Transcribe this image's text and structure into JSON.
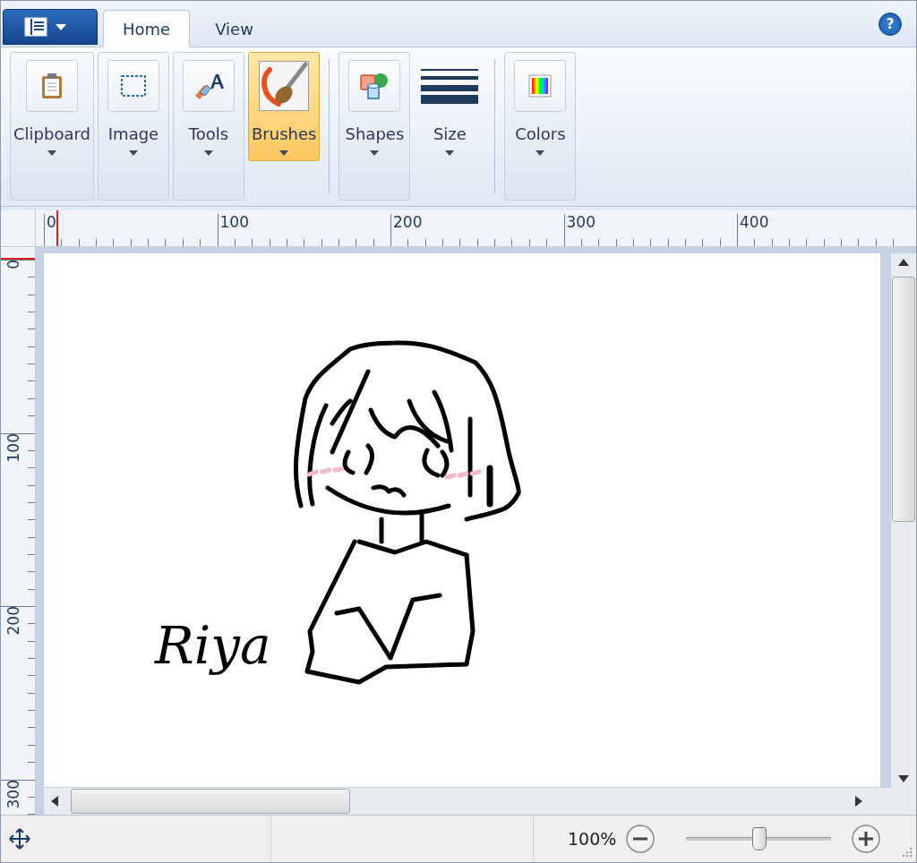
{
  "app_menu": {
    "expanded": false
  },
  "tabs": [
    {
      "label": "Home",
      "selected": true
    },
    {
      "label": "View",
      "selected": false
    }
  ],
  "help_button": {
    "label": "?"
  },
  "ribbon": [
    {
      "kind": "group",
      "label": "Clipboard",
      "selected": false
    },
    {
      "kind": "group",
      "label": "Image",
      "selected": false
    },
    {
      "kind": "group",
      "label": "Tools",
      "selected": false
    },
    {
      "kind": "group",
      "label": "Brushes",
      "selected": true
    },
    {
      "kind": "separator"
    },
    {
      "kind": "group",
      "label": "Shapes",
      "selected": false
    },
    {
      "kind": "plain",
      "label": "Size",
      "selected": false
    },
    {
      "kind": "separator"
    },
    {
      "kind": "group",
      "label": "Colors",
      "selected": false
    }
  ],
  "ruler": {
    "horizontal_labels": [
      "0",
      "100",
      "200",
      "300",
      "400"
    ],
    "vertical_labels": [
      "0",
      "100",
      "200",
      "300"
    ]
  },
  "canvas": {
    "signature": "Riya"
  },
  "status_bar": {
    "zoom": "100%",
    "level": 0.5
  }
}
